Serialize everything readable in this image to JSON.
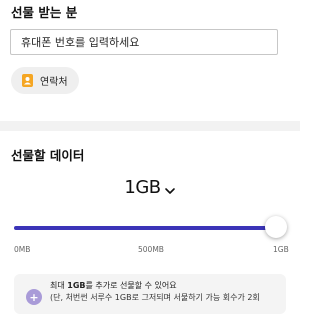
{
  "recipient": {
    "title": "선물 받는 분",
    "phone_placeholder": "휴대폰 번호를 입력하세요",
    "contact_button_label": "연락처",
    "contact_icon": "contact-book-icon"
  },
  "gift_data": {
    "title": "선물할 데이터",
    "selected_amount": "1GB",
    "slider": {
      "min_label": "0MB",
      "mid_label": "500MB",
      "max_label": "1GB",
      "value_fraction": 1.0
    }
  },
  "info": {
    "icon": "plus-icon",
    "line1_prefix": "최대 ",
    "line1_highlight": "1GB",
    "line1_suffix": "를 추가로 선물할 수 있어요",
    "line2": "(단, 처번썬 서루수 1GB로 그저되며 서물하기 가능 회수가 2회"
  },
  "colors": {
    "accent": "#3b34b8",
    "contact_icon_bg": "#f5a623",
    "info_icon_bg": "#a99bd8"
  }
}
